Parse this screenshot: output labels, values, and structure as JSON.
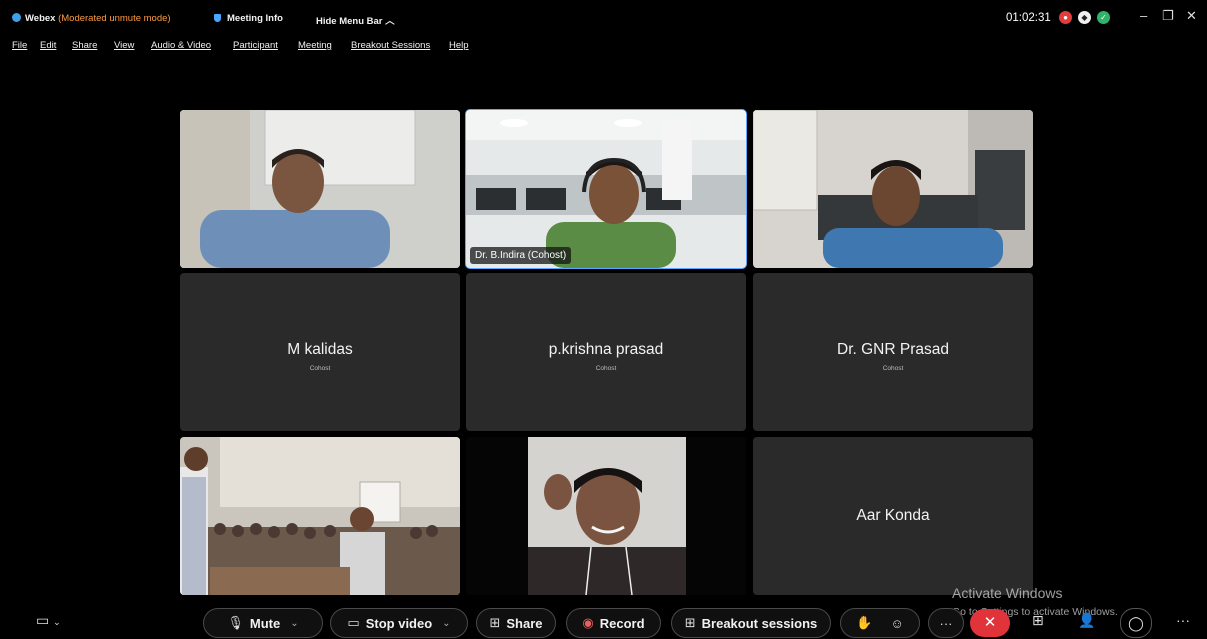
{
  "titlebar": {
    "app_name": "Webex",
    "mode": "(Moderated unmute mode)",
    "meeting_info": "Meeting Info",
    "hide_menu": "Hide Menu Bar ︿",
    "clock": "01:02:31"
  },
  "window_controls": {
    "minimize": "–",
    "restore": "❐",
    "close": "✕"
  },
  "menu": [
    "File",
    "Edit",
    "Share",
    "View",
    "Audio & Video",
    "Participant",
    "Meeting",
    "Breakout Sessions",
    "Help"
  ],
  "participants": {
    "video_label": "Dr. B.Indira (Cohost)",
    "names": [
      {
        "name": "M kalidas",
        "role": "Cohost"
      },
      {
        "name": "p.krishna prasad",
        "role": "Cohost"
      },
      {
        "name": "Dr. GNR Prasad",
        "role": "Cohost"
      },
      {
        "name": "Aar Konda",
        "role": ""
      }
    ]
  },
  "toolbar": {
    "mute": "Mute",
    "stop_video": "Stop video",
    "share": "Share",
    "record": "Record",
    "breakout": "Breakout sessions"
  },
  "watermark": {
    "line1": "Activate Windows",
    "line2": "Go to Settings to activate Windows."
  },
  "colors": {
    "accent": "#5aa9ff",
    "end_call": "#e0343a",
    "mode_text": "#ff9a3c"
  }
}
